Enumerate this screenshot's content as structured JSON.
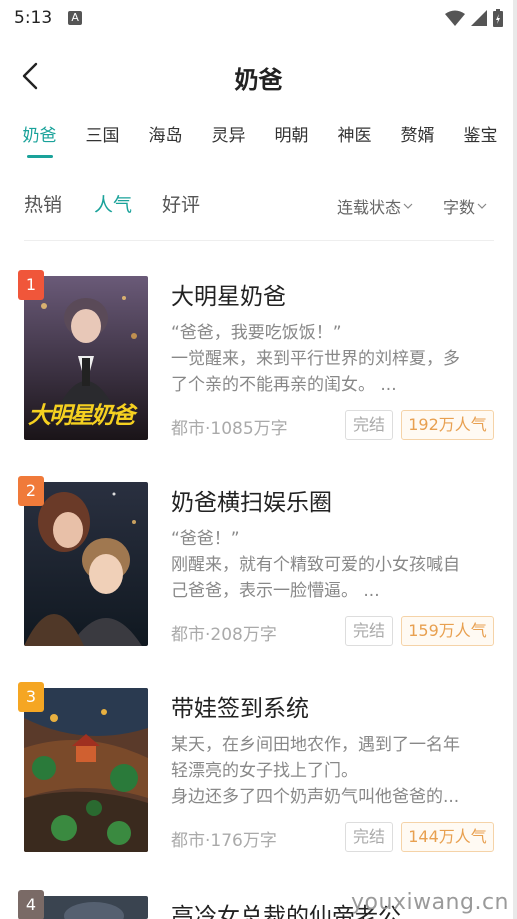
{
  "status_bar": {
    "time": "5:13",
    "notification_letter": "A"
  },
  "header": {
    "title": "奶爸"
  },
  "tabs": [
    {
      "label": "奶爸",
      "active": true
    },
    {
      "label": "三国",
      "active": false
    },
    {
      "label": "海岛",
      "active": false
    },
    {
      "label": "灵异",
      "active": false
    },
    {
      "label": "明朝",
      "active": false
    },
    {
      "label": "神医",
      "active": false
    },
    {
      "label": "赘婿",
      "active": false
    },
    {
      "label": "鉴宝",
      "active": false
    }
  ],
  "filters": {
    "sort": [
      {
        "label": "热销",
        "active": false
      },
      {
        "label": "人气",
        "active": true
      },
      {
        "label": "好评",
        "active": false
      }
    ],
    "status_dropdown": "连载状态",
    "words_dropdown": "字数"
  },
  "books": [
    {
      "rank": "1",
      "rank_color": "#f0563a",
      "title": "大明星奶爸",
      "cover_text": "大明星奶爸",
      "desc": [
        "“爸爸，我要吃饭饭！”",
        "一觉醒来，来到平行世界的刘梓夏，多",
        "了个亲的不能再亲的闺女。 ..."
      ],
      "meta": "都市·1085万字",
      "status": "完结",
      "popularity": "192万人气"
    },
    {
      "rank": "2",
      "rank_color": "#f07a3a",
      "title": "奶爸横扫娱乐圈",
      "desc": [
        "“爸爸！”",
        "刚醒来，就有个精致可爱的小女孩喊自",
        "己爸爸，表示一脸懵逼。 ..."
      ],
      "meta": "都市·208万字",
      "status": "完结",
      "popularity": "159万人气"
    },
    {
      "rank": "3",
      "rank_color": "#f5a623",
      "title": "带娃签到系统",
      "desc": [
        "某天，在乡间田地农作，遇到了一名年",
        "轻漂亮的女子找上了门。",
        "身边还多了四个奶声奶气叫他爸爸的..."
      ],
      "meta": "都市·176万字",
      "status": "完结",
      "popularity": "144万人气"
    },
    {
      "rank": "4",
      "rank_color": "#7a6a66",
      "title": "高冷女总裁的仙帝老公"
    }
  ],
  "watermark": "youxiwang.cn",
  "colors": {
    "accent": "#1aa29a",
    "popularity": "#e8a050"
  }
}
